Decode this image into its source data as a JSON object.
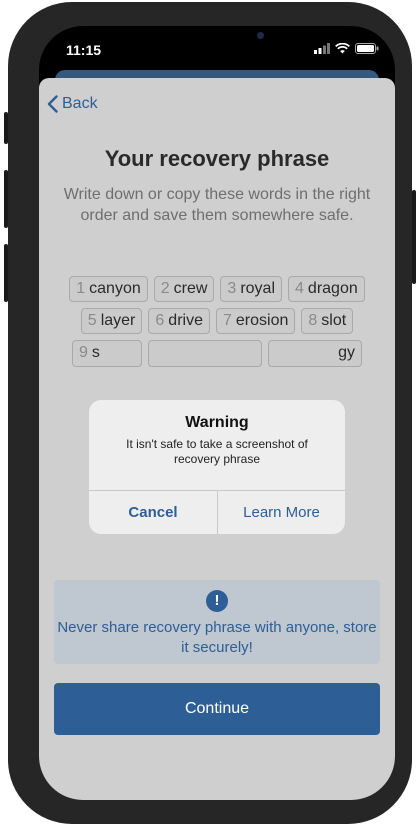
{
  "status_bar": {
    "time": "11:15"
  },
  "nav": {
    "back_label": "Back"
  },
  "page": {
    "title": "Your recovery phrase",
    "subtitle": "Write down or copy these words in the right order and save them somewhere safe."
  },
  "words": [
    {
      "num": "1",
      "word": "canyon"
    },
    {
      "num": "2",
      "word": "crew"
    },
    {
      "num": "3",
      "word": "royal"
    },
    {
      "num": "4",
      "word": "dragon"
    },
    {
      "num": "5",
      "word": "layer"
    },
    {
      "num": "6",
      "word": "drive"
    },
    {
      "num": "7",
      "word": "erosion"
    },
    {
      "num": "8",
      "word": "slot"
    },
    {
      "num": "9",
      "word": "s"
    },
    {
      "num": "",
      "word": ""
    },
    {
      "num": "",
      "word": "gy"
    }
  ],
  "notice": {
    "icon": "exclamation-icon",
    "text": "Never share recovery phrase with anyone, store it securely!"
  },
  "continue_label": "Continue",
  "alert": {
    "title": "Warning",
    "message": "It isn't safe to take a screenshot of recovery phrase",
    "cancel_label": "Cancel",
    "learn_more_label": "Learn More"
  },
  "colors": {
    "accent": "#2d5e95",
    "overlay_background": "#cfcfcf",
    "alert_background": "#eeeeee"
  }
}
